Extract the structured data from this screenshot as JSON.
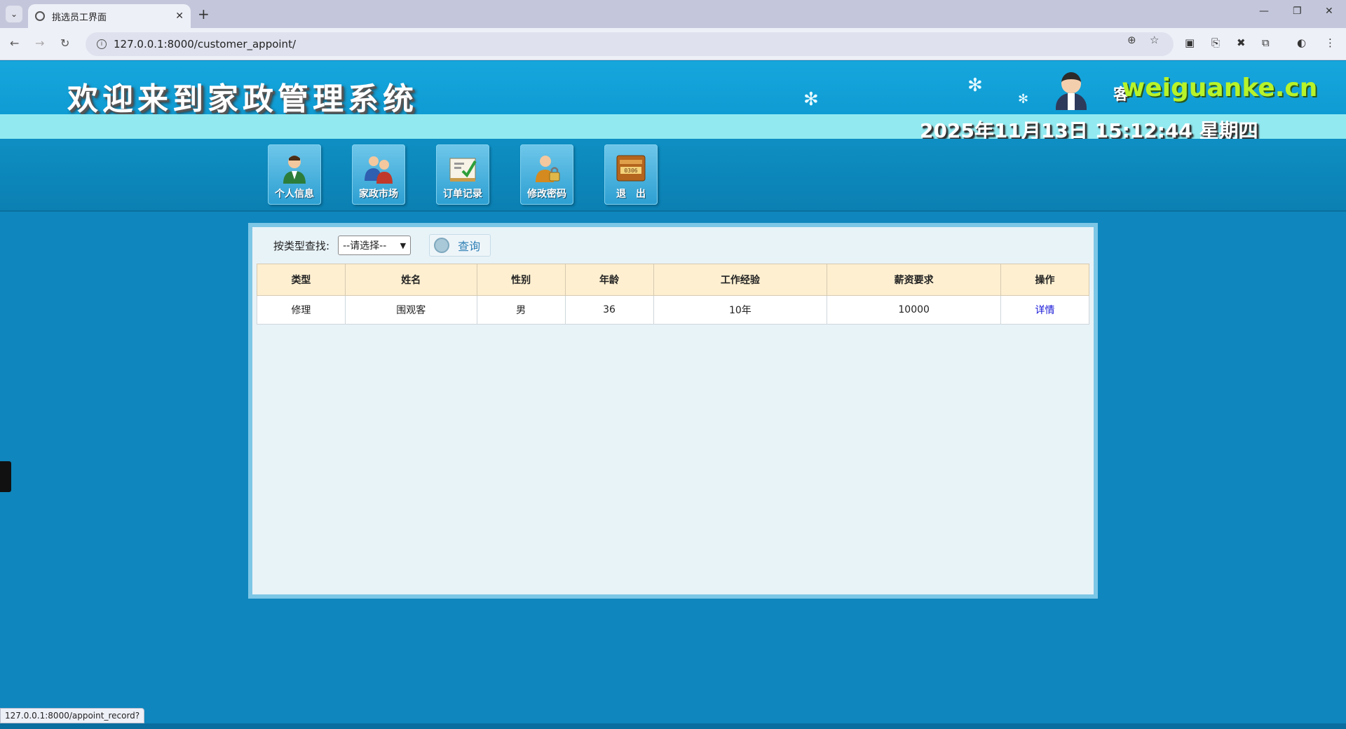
{
  "browser": {
    "tab_title": "挑选员工界面",
    "url": "127.0.0.1:8000/customer_appoint/",
    "status_url": "127.0.0.1:8000/appoint_record?"
  },
  "header": {
    "site_title": "欢迎来到家政管理系统",
    "role_label": "客",
    "watermark": "weiguanke.cn",
    "datetime": "2025年11月13日 15:12:44 星期四"
  },
  "menu": {
    "items": [
      {
        "label": "个人信息",
        "icon": "person-icon"
      },
      {
        "label": "家政市场",
        "icon": "group-icon"
      },
      {
        "label": "订单记录",
        "icon": "document-icon"
      },
      {
        "label": "修改密码",
        "icon": "lock-user-icon"
      },
      {
        "label": "退　出",
        "icon": "exit-icon"
      }
    ]
  },
  "search": {
    "label": "按类型查找:",
    "select_value": "--请选择--",
    "button_label": "查询"
  },
  "table": {
    "headers": [
      "类型",
      "姓名",
      "性别",
      "年龄",
      "工作经验",
      "薪资要求",
      "操作"
    ],
    "rows": [
      [
        "修理",
        "围观客",
        "男",
        "36",
        "10年",
        "10000",
        "详情"
      ]
    ]
  },
  "colors": {
    "header_blue": "#16a7dd",
    "date_bar": "#92eaf0",
    "table_header": "#fdefd0",
    "link": "#1515d8",
    "watermark": "#b7f32a"
  }
}
